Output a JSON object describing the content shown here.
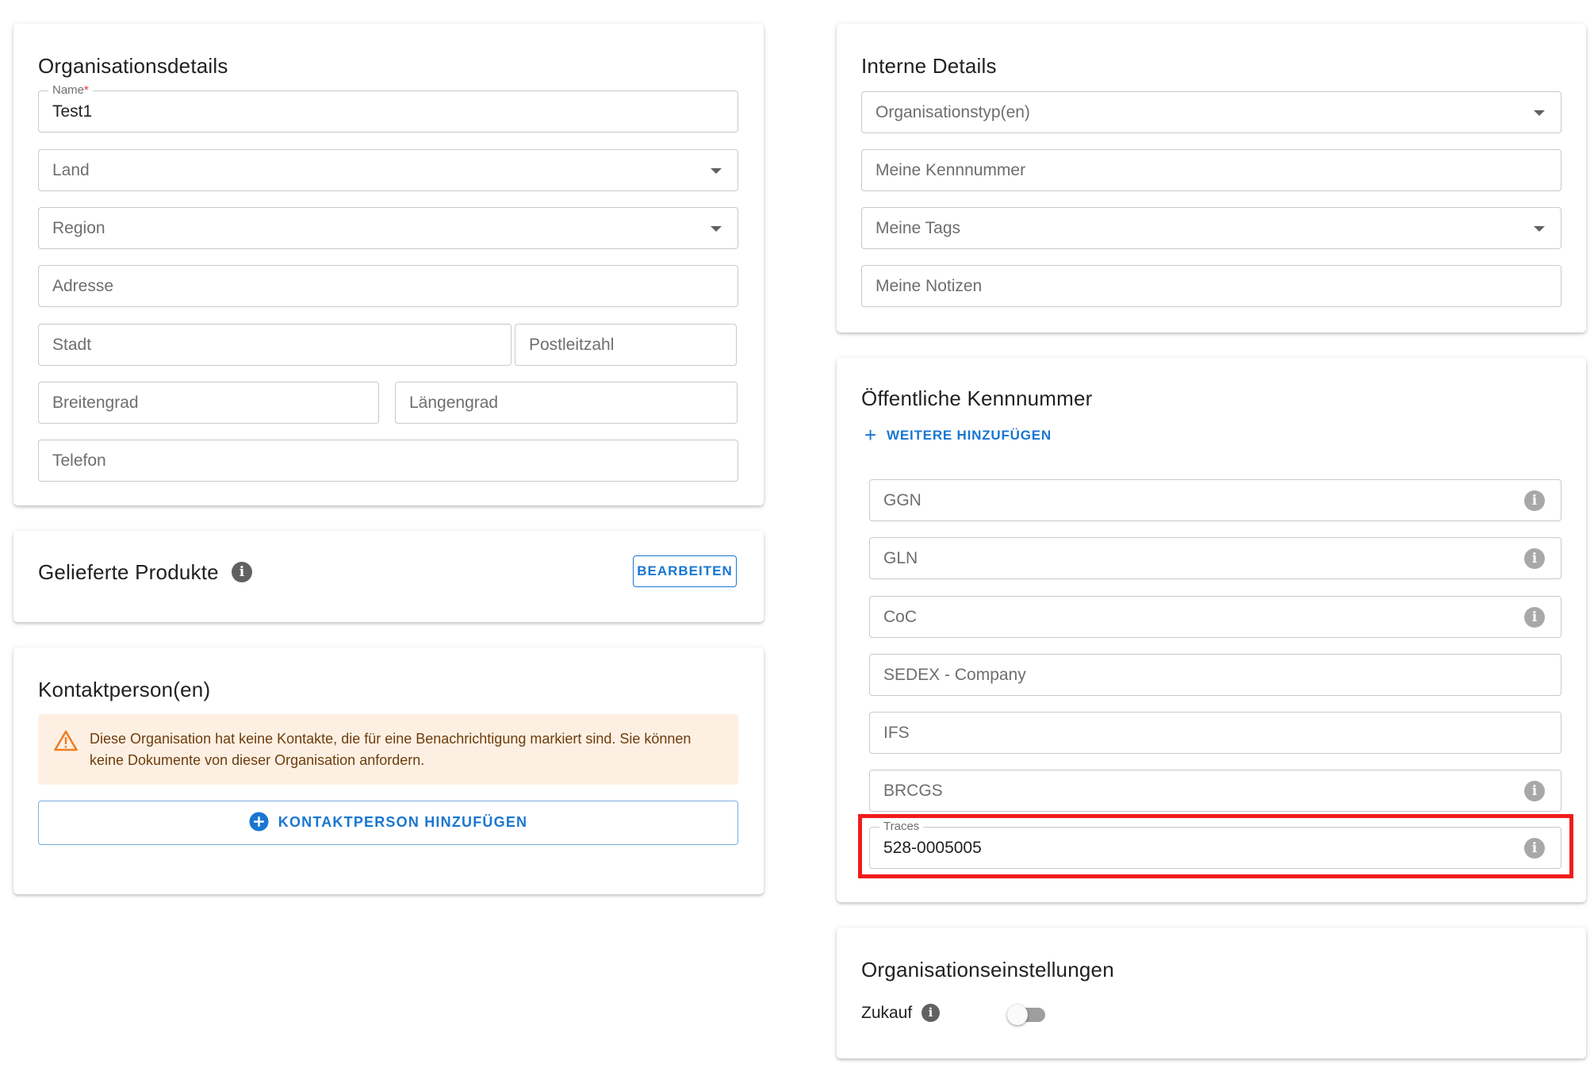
{
  "org_details": {
    "title": "Organisationsdetails",
    "name_label": "Name",
    "name_required": "*",
    "name_value": "Test1",
    "land": "Land",
    "region": "Region",
    "adresse": "Adresse",
    "stadt": "Stadt",
    "postleitzahl": "Postleitzahl",
    "breitengrad": "Breitengrad",
    "laengengrad": "Längengrad",
    "telefon": "Telefon"
  },
  "products": {
    "title": "Gelieferte Produkte",
    "edit_button": "BEARBEITEN"
  },
  "contacts": {
    "title": "Kontaktperson(en)",
    "warning": "Diese Organisation hat keine Kontakte, die für eine Benachrichtigung markiert sind. Sie können keine Dokumente von dieser Organisation anfordern.",
    "add_button": "KONTAKTPERSON HINZUFÜGEN"
  },
  "internal": {
    "title": "Interne Details",
    "org_types": "Organisationstyp(en)",
    "my_id": "Meine Kennnummer",
    "my_tags": "Meine Tags",
    "my_notes": "Meine Notizen"
  },
  "public_ids": {
    "title": "Öffentliche Kennnummer",
    "add_more": "WEITERE HINZUFÜGEN",
    "ggn": "GGN",
    "gln": "GLN",
    "coc": "CoC",
    "sedex": "SEDEX - Company",
    "ifs": "IFS",
    "brcgs": "BRCGS",
    "traces_label": "Traces",
    "traces_value": "528-0005005"
  },
  "settings": {
    "title": "Organisationseinstellungen",
    "zukauf": "Zukauf",
    "zukauf_enabled": false
  },
  "colors": {
    "accent": "#1976d2",
    "highlight": "#f21c1c",
    "warning_bg": "#fdf0e3",
    "warning_icon": "#ef7d22"
  }
}
